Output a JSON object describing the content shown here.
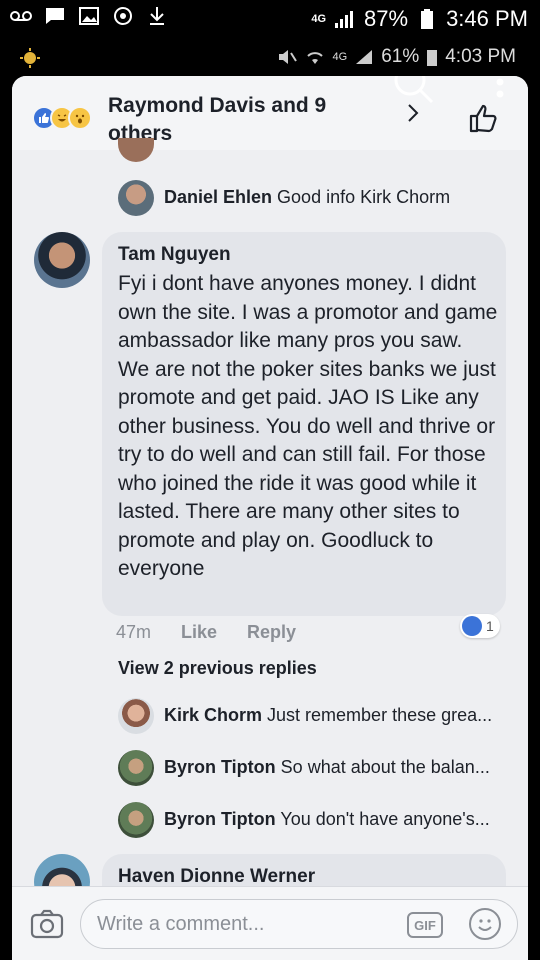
{
  "status_outer": {
    "signal_label": "4G",
    "battery": "87%",
    "time": "3:46 PM"
  },
  "status_inner": {
    "network": "4G",
    "battery": "61%",
    "time": "4:03 PM"
  },
  "header": {
    "title": "Raymond Davis and 9 others"
  },
  "replies_top": [
    {
      "name": "Daniel Ehlen",
      "text": "Good info Kirk Chorm"
    }
  ],
  "main_comment": {
    "name": "Tam Nguyen",
    "text": "Fyi i dont have anyones money. I didnt own the site. I was a promotor and game ambassador like many pros you saw. We are not the poker sites banks we just promote and get paid.  JAO IS Like any other business. You do well and thrive or try to do well and can still fail. For those who joined the ride it was good while it lasted. There are many other sites to promote and play on. Goodluck to everyone",
    "time": "47m",
    "like_label": "Like",
    "reply_label": "Reply",
    "like_count": "1"
  },
  "view_previous": "View 2 previous replies",
  "replies": [
    {
      "name": "Kirk Chorm",
      "text": "Just remember these grea..."
    },
    {
      "name": "Byron Tipton",
      "text": "So what about the balan..."
    },
    {
      "name": "Byron Tipton",
      "text": "You don't have anyone's..."
    }
  ],
  "next_comment": {
    "name": "Haven Dionne Werner"
  },
  "composer": {
    "placeholder": "Write a comment...",
    "gif_label": "GIF"
  },
  "colors": {
    "like_blue": "#3b73d8",
    "panel_bg": "#eeeff2",
    "text": "#1d2129",
    "muted": "#8b8f96"
  }
}
